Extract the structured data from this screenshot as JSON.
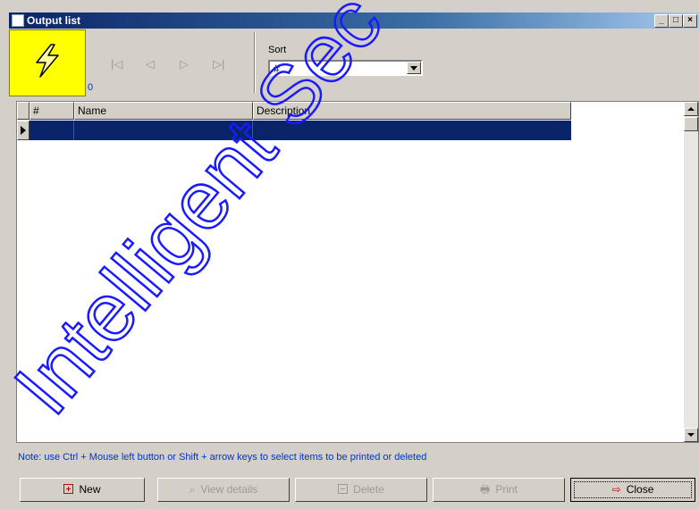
{
  "window": {
    "title": "Output list",
    "controls": [
      "minimize",
      "maximize",
      "close"
    ]
  },
  "toolbar": {
    "counter": "0",
    "nav_buttons": [
      {
        "name": "first-record-icon",
        "glyph": "⏮"
      },
      {
        "name": "prev-record-icon",
        "glyph": "◁"
      },
      {
        "name": "next-record-icon",
        "glyph": "▷"
      },
      {
        "name": "last-record-icon",
        "glyph": "⏭"
      }
    ],
    "sort_label": "Sort",
    "sort_value": "#"
  },
  "grid": {
    "columns": [
      "#",
      "Name",
      "Description"
    ],
    "rows": [
      {
        "num": "",
        "name": "",
        "description": "",
        "selected": true
      }
    ]
  },
  "note": "Note: use Ctrl + Mouse left button or Shift + arrow keys to select items to be printed or deleted",
  "buttons": {
    "new": "New",
    "view_details": "View details",
    "delete": "Delete",
    "print": "Print",
    "close": "Close"
  },
  "watermark": "Intelligent Sec",
  "colors": {
    "title_bar": "#0a246a",
    "selection": "#0a246a",
    "note_text": "#0033cc",
    "watermark": "#1a1aff",
    "logo_bg": "#ffff00"
  }
}
